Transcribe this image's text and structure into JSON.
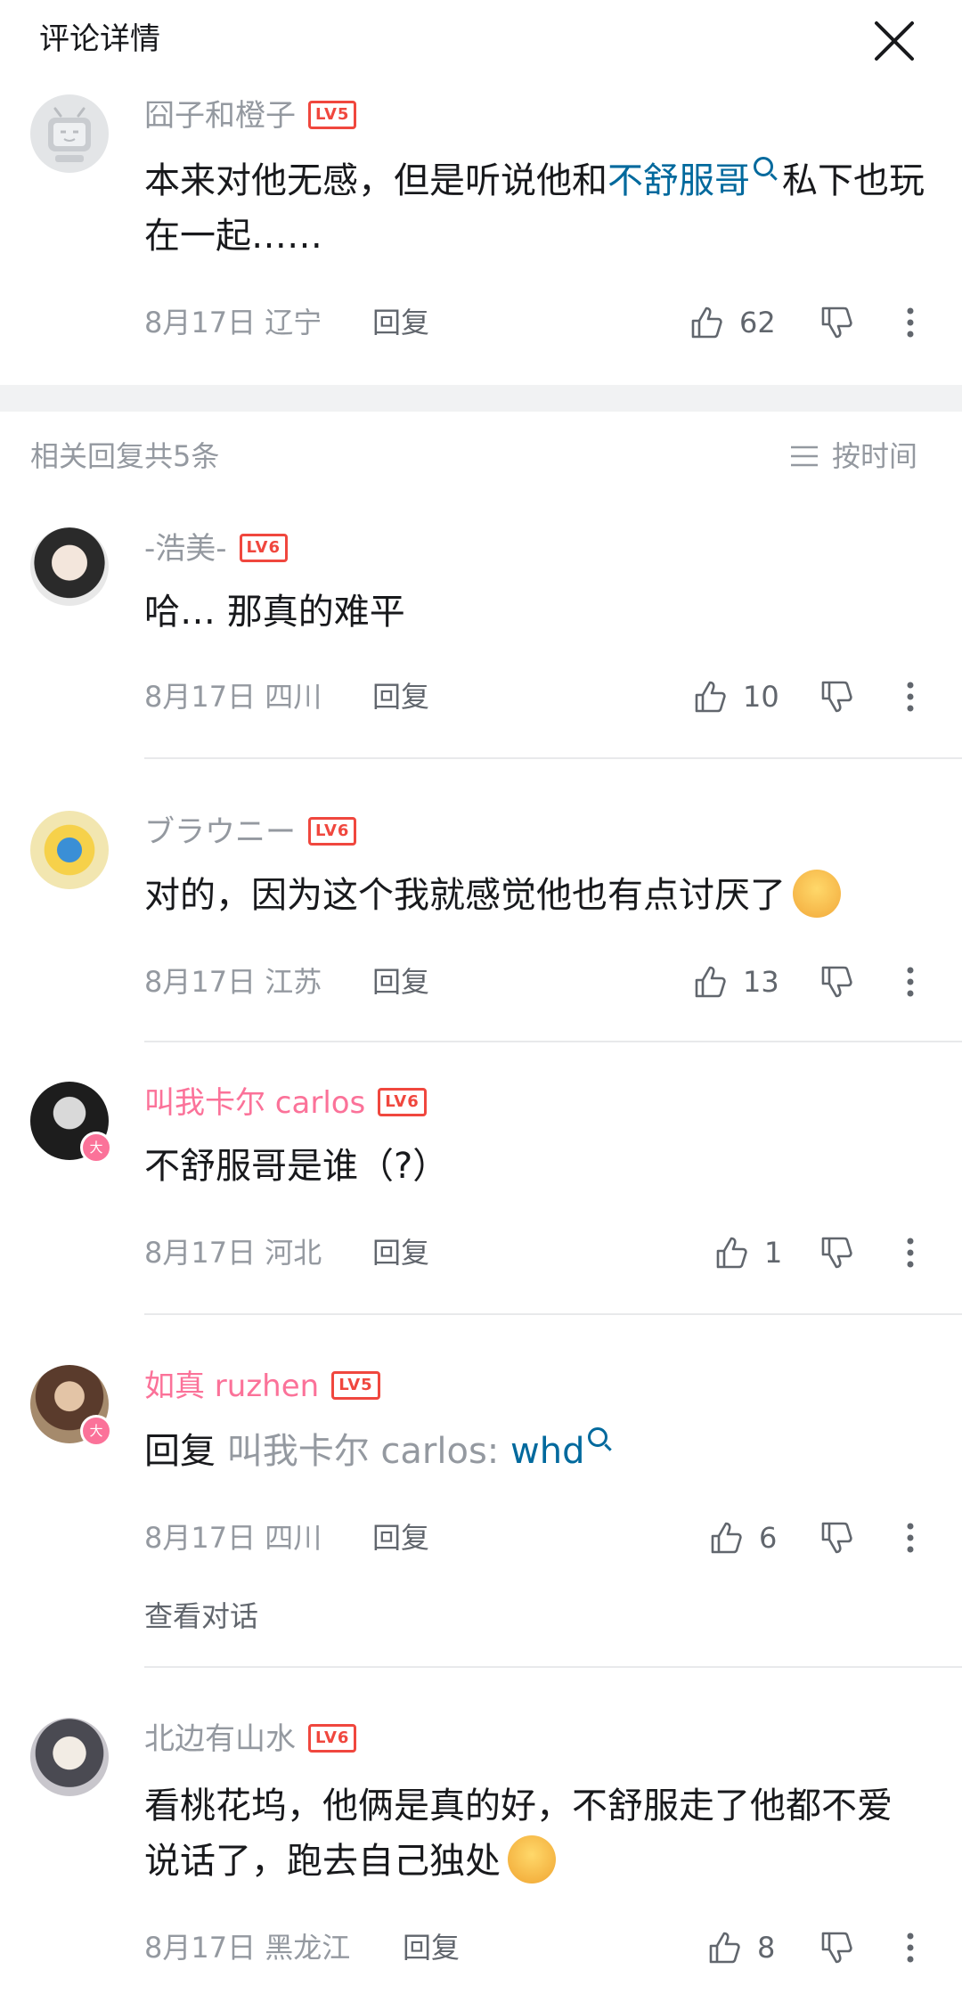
{
  "header": {
    "title": "评论详情"
  },
  "main_comment": {
    "username": "囧子和橙子",
    "level": "LV5",
    "content_before": "本来对他无感，但是听说他和",
    "content_link": "不舒服哥",
    "content_after": "私下也玩在一起……",
    "date": "8月17日",
    "location": "辽宁",
    "reply_label": "回复",
    "likes": "62"
  },
  "replies_section": {
    "title": "相关回复共5条",
    "sort_label": "按时间"
  },
  "replies": [
    {
      "username": "-浩美-",
      "level": "LV6",
      "content": "哈… 那真的难平",
      "date": "8月17日",
      "location": "四川",
      "reply_label": "回复",
      "likes": "10"
    },
    {
      "username": "ブラウニー",
      "level": "LV6",
      "content": "对的，因为这个我就感觉他也有点讨厌了",
      "emoji": "sweat-smile-emoji",
      "date": "8月17日",
      "location": "江苏",
      "reply_label": "回复",
      "likes": "13"
    },
    {
      "username": "叫我卡尔 carlos",
      "level": "LV6",
      "content": "不舒服哥是谁（?）",
      "date": "8月17日",
      "location": "河北",
      "reply_label": "回复",
      "likes": "1",
      "vip_badge": "大"
    },
    {
      "username": "如真 ruzhen",
      "level": "LV5",
      "content_prefix": "回复 ",
      "content_mention": "叫我卡尔 carlos:",
      "content_link": "whd",
      "date": "8月17日",
      "location": "四川",
      "reply_label": "回复",
      "likes": "6",
      "vip_badge": "大",
      "view_conversation": "查看对话"
    },
    {
      "username": "北边有山水",
      "level": "LV6",
      "content": "看桃花坞，他俩是真的好，不舒服走了他都不爱说话了，跑去自己独处",
      "emoji": "crying-laugh-emoji",
      "date": "8月17日",
      "location": "黑龙江",
      "reply_label": "回复",
      "likes": "8"
    }
  ],
  "colors": {
    "accent_link": "#00699d",
    "vip_pink": "#fb7299",
    "level_red": "#f0473e",
    "muted": "#9499a0"
  }
}
